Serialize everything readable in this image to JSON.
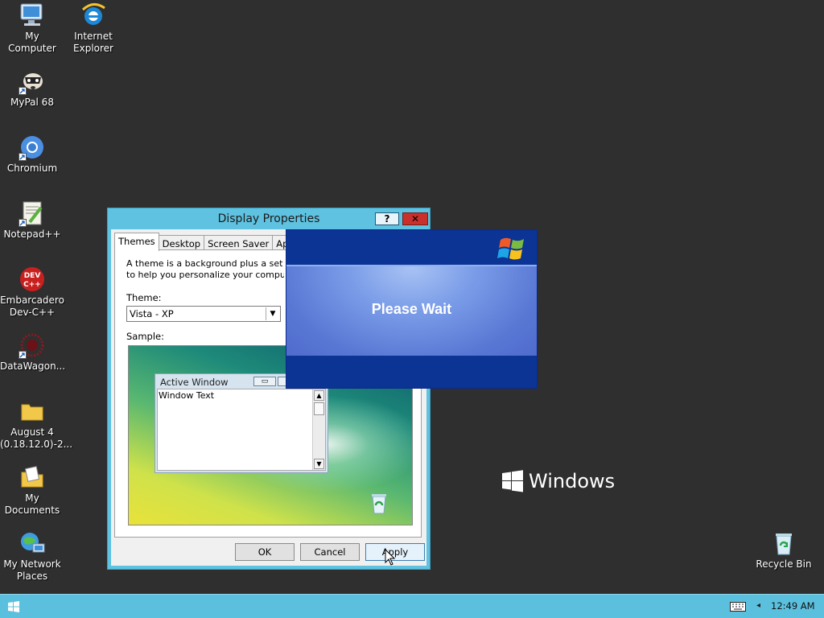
{
  "desktop": {
    "icons": [
      {
        "label": "My Computer"
      },
      {
        "label": "Internet Explorer"
      },
      {
        "label": "MyPal 68"
      },
      {
        "label": "Chromium"
      },
      {
        "label": "Notepad++"
      },
      {
        "label": "Embarcadero Dev-C++"
      },
      {
        "label": "DataWagon..."
      },
      {
        "label": "August 4 (0.18.12.0)-2..."
      },
      {
        "label": "My Documents"
      },
      {
        "label": "My Network Places"
      },
      {
        "label": "Recycle Bin"
      }
    ],
    "brand_text": "Windows"
  },
  "display_properties": {
    "title": "Display Properties",
    "help_label": "?",
    "close_label": "✕",
    "tabs": [
      {
        "label": "Themes"
      },
      {
        "label": "Desktop"
      },
      {
        "label": "Screen Saver"
      },
      {
        "label": "Appea"
      }
    ],
    "active_tab": "Themes",
    "description_line1": "A theme is a background plus a set of sou",
    "description_line2": "to help you personalize your computer with",
    "theme_label": "Theme:",
    "theme_value": "Vista - XP",
    "sample_label": "Sample:",
    "sample_window": {
      "title": "Active Window",
      "text": "Window Text"
    },
    "buttons": {
      "ok": "OK",
      "cancel": "Cancel",
      "apply": "Apply"
    }
  },
  "please_wait": {
    "message": "Please Wait"
  },
  "taskbar": {
    "clock": "12:49 AM",
    "tray_arrow": "◂"
  }
}
